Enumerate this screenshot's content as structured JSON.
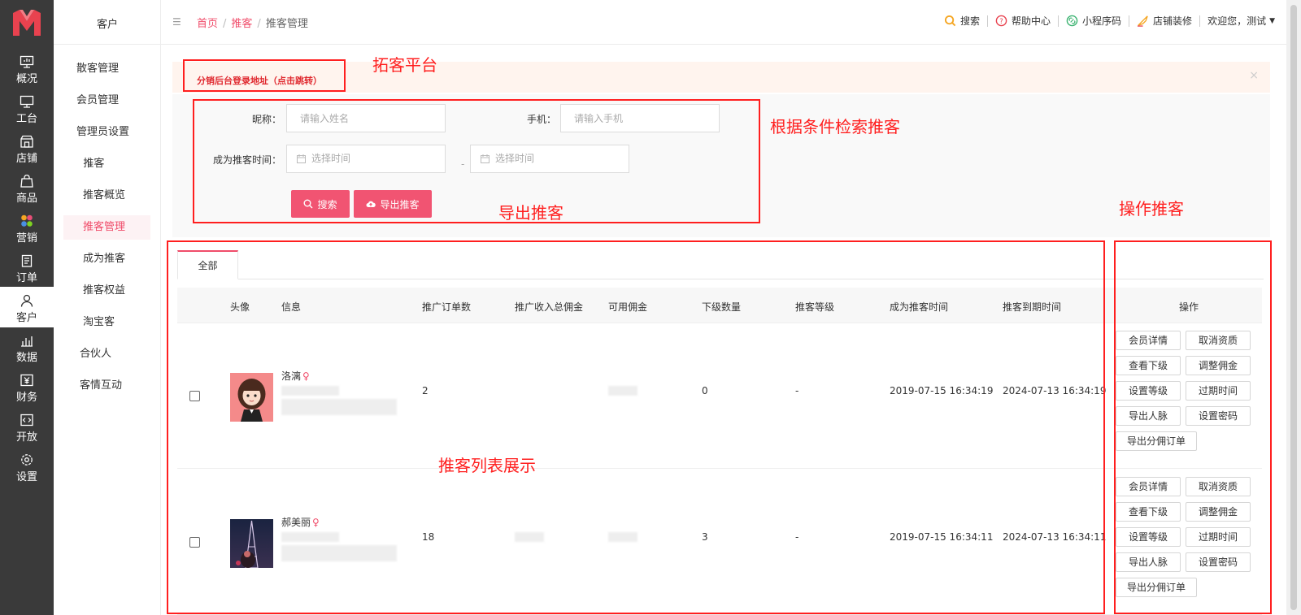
{
  "rail": {
    "items": [
      {
        "label": "概况",
        "icon": "monitor-icon"
      },
      {
        "label": "工台",
        "icon": "desktop-icon"
      },
      {
        "label": "店铺",
        "icon": "store-icon"
      },
      {
        "label": "商品",
        "icon": "bag-icon"
      },
      {
        "label": "营销",
        "icon": "colorful-dots-icon"
      },
      {
        "label": "订单",
        "icon": "order-icon"
      },
      {
        "label": "客户",
        "icon": "user-icon"
      },
      {
        "label": "数据",
        "icon": "bar-chart-icon"
      },
      {
        "label": "财务",
        "icon": "yen-icon"
      },
      {
        "label": "开放",
        "icon": "code-icon"
      },
      {
        "label": "设置",
        "icon": "gear-icon"
      }
    ],
    "active_index": 6,
    "brand_color": "#e8424f"
  },
  "sub": {
    "title": "客户",
    "items": [
      {
        "label": "散客管理"
      },
      {
        "label": "会员管理"
      },
      {
        "label": "管理员设置"
      },
      {
        "label": "推客"
      },
      {
        "label": "推客概览"
      },
      {
        "label": "推客管理"
      },
      {
        "label": "成为推客"
      },
      {
        "label": "推客权益"
      },
      {
        "label": "淘宝客"
      },
      {
        "label": "合伙人"
      },
      {
        "label": "客情互动"
      }
    ]
  },
  "topbar": {
    "breadcrumb": {
      "home": "首页",
      "parent": "推客",
      "current": "推客管理"
    },
    "actions": {
      "search": "搜索",
      "help": "帮助中心",
      "miniapp": "小程序码",
      "decorate": "店铺装修",
      "welcome": "欢迎您，测试"
    }
  },
  "notice": {
    "link": "分销后台登录地址（点击跳转）",
    "close": "×"
  },
  "filter": {
    "nickname_label": "昵称：",
    "nickname_placeholder": "请输入姓名",
    "phone_label": "手机：",
    "phone_placeholder": "请输入手机",
    "time_label": "成为推客时间：",
    "date_placeholder": "选择时间",
    "date_sep": "-",
    "search_btn": "搜索",
    "export_btn": "导出推客"
  },
  "tabs": {
    "all": "全部"
  },
  "table": {
    "headers": {
      "avatar": "头像",
      "info": "信息",
      "orders": "推广订单数",
      "income": "推广收入总佣金",
      "available": "可用佣金",
      "subordinates": "下级数量",
      "level": "推客等级",
      "became_time": "成为推客时间",
      "expire_time": "推客到期时间",
      "ops": "操作"
    },
    "rows": [
      {
        "name": "洛漓",
        "sex": "♀",
        "orders": "2",
        "subordinates": "0",
        "level": "-",
        "became_time": "2019-07-15 16:34:19",
        "expire_time": "2024-07-13 16:34:19"
      },
      {
        "name": "郝美丽",
        "sex": "♀",
        "orders": "18",
        "subordinates": "3",
        "level": "-",
        "became_time": "2019-07-15 16:34:11",
        "expire_time": "2024-07-13 16:34:11"
      }
    ],
    "op_labels": [
      "会员详情",
      "取消资质",
      "查看下级",
      "调整佣金",
      "设置等级",
      "过期时间",
      "导出人脉",
      "设置密码",
      "导出分佣订单"
    ]
  },
  "annotations": {
    "platform": "拓客平台",
    "search": "根据条件检索推客",
    "export": "导出推客",
    "operate": "操作推客",
    "list": "推客列表展示"
  },
  "colors": {
    "accent": "#f04c6a",
    "annotation": "#ff1f1f",
    "rail": "#3a3a3a"
  }
}
